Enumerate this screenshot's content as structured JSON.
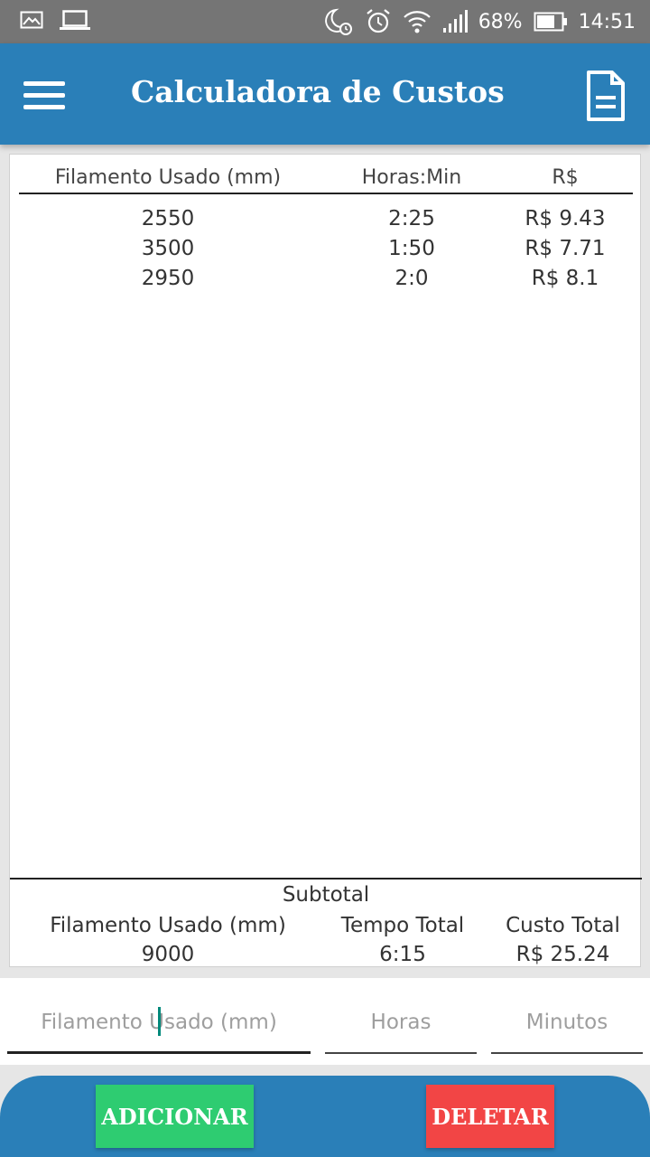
{
  "status_bar": {
    "left_icons": [
      "image-icon",
      "laptop-icon"
    ],
    "right_icons": [
      "night-mode-icon",
      "alarm-icon",
      "wifi-icon",
      "signal-icon",
      "battery-icon"
    ],
    "battery": "68%",
    "time": "14:51"
  },
  "app_bar": {
    "title": "Calculadora de Custos",
    "menu_icon": "menu-icon",
    "action_icon": "document-icon"
  },
  "table": {
    "headers": [
      "Filamento Usado (mm)",
      "Horas:Min",
      "R$"
    ],
    "rows": [
      [
        "2550",
        "2:25",
        "R$ 9.43"
      ],
      [
        "3500",
        "1:50",
        "R$ 7.71"
      ],
      [
        "2950",
        "2:0",
        "R$ 8.1"
      ]
    ]
  },
  "subtotal": {
    "title": "Subtotal",
    "headers": [
      "Filamento Usado (mm)",
      "Tempo Total",
      "Custo Total"
    ],
    "values": [
      "9000",
      "6:15",
      "R$ 25.24"
    ]
  },
  "inputs": {
    "filament_placeholder": "Filamento Usado (mm)",
    "hours_placeholder": "Horas",
    "minutes_placeholder": "Minutos"
  },
  "buttons": {
    "add_label": "ADICIONAR",
    "delete_label": "DELETAR"
  },
  "colors": {
    "primary": "#2a7fb8",
    "add": "#2ecc71",
    "delete": "#f24545",
    "status_bar": "#757575"
  }
}
